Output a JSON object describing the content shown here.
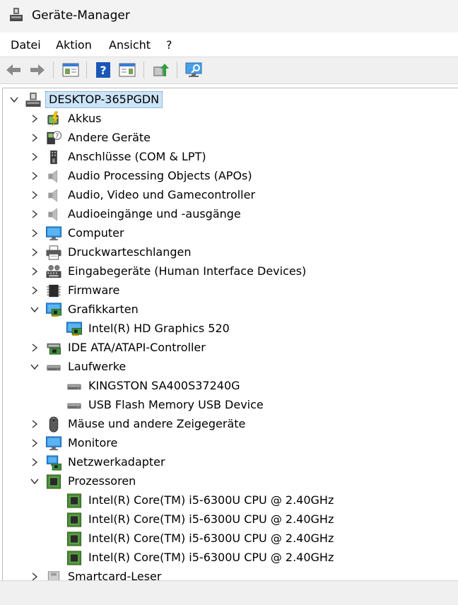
{
  "window": {
    "title": "Geräte-Manager"
  },
  "menu": [
    "Datei",
    "Aktion",
    "Ansicht",
    "?"
  ],
  "toolbar": {
    "buttons": [
      "back-arrow-icon",
      "forward-arrow-icon",
      "console-tree-icon",
      "help-icon",
      "action-pane-icon",
      "update-driver-icon",
      "scan-hardware-icon"
    ]
  },
  "tree": {
    "root": "DESKTOP-365PGDN",
    "categories": [
      {
        "label": "Akkus",
        "icon": "battery-icon",
        "expanded": false
      },
      {
        "label": "Andere Geräte",
        "icon": "unknown-device-icon",
        "expanded": false
      },
      {
        "label": "Anschlüsse (COM & LPT)",
        "icon": "port-icon",
        "expanded": false
      },
      {
        "label": "Audio Processing Objects (APOs)",
        "icon": "speaker-icon",
        "expanded": false
      },
      {
        "label": "Audio, Video und Gamecontroller",
        "icon": "speaker-icon",
        "expanded": false
      },
      {
        "label": "Audioeingänge und -ausgänge",
        "icon": "speaker-icon",
        "expanded": false
      },
      {
        "label": "Computer",
        "icon": "monitor-icon",
        "expanded": false
      },
      {
        "label": "Druckwarteschlangen",
        "icon": "printer-icon",
        "expanded": false
      },
      {
        "label": "Eingabegeräte (Human Interface Devices)",
        "icon": "hid-icon",
        "expanded": false
      },
      {
        "label": "Firmware",
        "icon": "chip-icon",
        "expanded": false
      },
      {
        "label": "Grafikkarten",
        "icon": "display-adapter-icon",
        "expanded": true,
        "children": [
          {
            "label": "Intel(R) HD Graphics 520",
            "icon": "display-adapter-icon"
          }
        ]
      },
      {
        "label": "IDE ATA/ATAPI-Controller",
        "icon": "ide-controller-icon",
        "expanded": false
      },
      {
        "label": "Laufwerke",
        "icon": "drive-icon",
        "expanded": true,
        "children": [
          {
            "label": "KINGSTON SA400S37240G",
            "icon": "drive-icon"
          },
          {
            "label": "USB Flash Memory USB Device",
            "icon": "drive-icon"
          }
        ]
      },
      {
        "label": "Mäuse und andere Zeigegeräte",
        "icon": "mouse-icon",
        "expanded": false
      },
      {
        "label": "Monitore",
        "icon": "monitor-icon",
        "expanded": false
      },
      {
        "label": "Netzwerkadapter",
        "icon": "network-adapter-icon",
        "expanded": false
      },
      {
        "label": "Prozessoren",
        "icon": "processor-icon",
        "expanded": true,
        "children": [
          {
            "label": "Intel(R) Core(TM) i5-6300U CPU @ 2.40GHz",
            "icon": "processor-icon"
          },
          {
            "label": "Intel(R) Core(TM) i5-6300U CPU @ 2.40GHz",
            "icon": "processor-icon"
          },
          {
            "label": "Intel(R) Core(TM) i5-6300U CPU @ 2.40GHz",
            "icon": "processor-icon"
          },
          {
            "label": "Intel(R) Core(TM) i5-6300U CPU @ 2.40GHz",
            "icon": "processor-icon"
          }
        ]
      },
      {
        "label": "Smartcard-Leser",
        "icon": "smartcard-reader-icon",
        "expanded": false
      }
    ]
  },
  "colors": {
    "selection": "#cce4f7",
    "accent": "#0078d4"
  }
}
